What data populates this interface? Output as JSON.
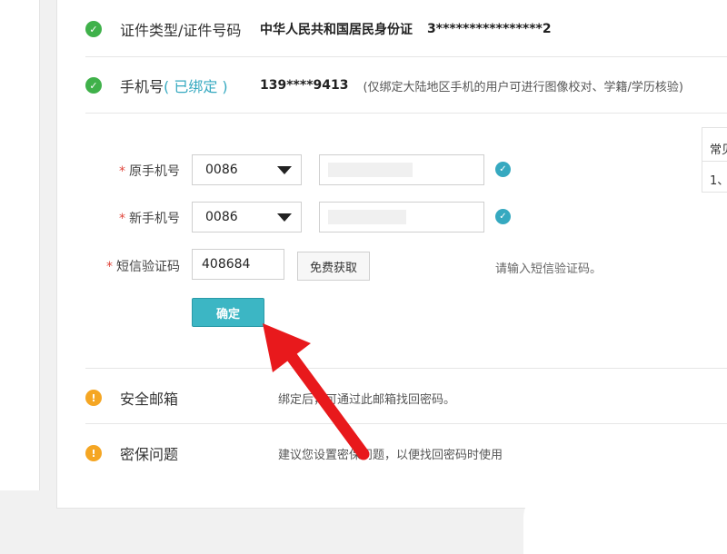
{
  "id_row": {
    "title": "证件类型/证件号码",
    "id_type": "中华人民共和国居民身份证",
    "id_number": "3****************2"
  },
  "phone_row": {
    "title": "手机号",
    "bound_badge": "( 已绑定 )",
    "phone": "139****9413",
    "note": "(仅绑定大陆地区手机的用户可进行图像校对、学籍/学历核验)"
  },
  "form": {
    "required_mark": "*",
    "old_phone_label": "原手机号",
    "new_phone_label": "新手机号",
    "sms_label": "短信验证码",
    "old_country_code": "0086",
    "new_country_code": "0086",
    "sms_value": "408684",
    "get_code_label": "免费获取",
    "sms_hint": "请输入短信验证码。",
    "confirm_label": "确定"
  },
  "faq": {
    "title": "常见",
    "line1": "1、"
  },
  "email_row": {
    "title": "安全邮箱",
    "desc": "绑定后，可通过此邮箱找回密码。"
  },
  "security_q_row": {
    "title": "密保问题",
    "desc": "建议您设置密保问题，以便找回密码时使用"
  },
  "icons": {
    "ok_glyph": "✓",
    "warn_glyph": "!",
    "check_glyph": "✓"
  },
  "colors": {
    "accent": "#36a9c0",
    "ok": "#3fb14a",
    "warn": "#f5a623",
    "required": "#e0463c",
    "arrow": "#e8191c"
  }
}
